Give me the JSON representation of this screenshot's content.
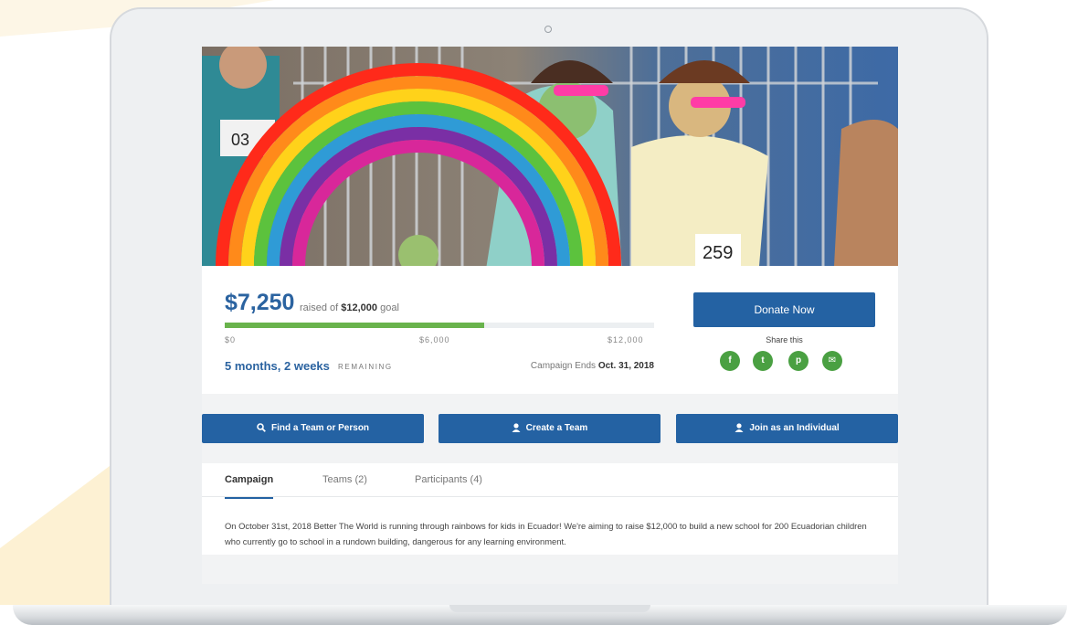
{
  "campaign": {
    "raised_amount": "$7,250",
    "raised_of": "raised of",
    "goal_amount": "$12,000",
    "goal_suffix": "goal",
    "progress_fraction": 0.6042,
    "ticks": [
      "$0",
      "$6,000",
      "$12,000"
    ],
    "remaining_value": "5 months, 2 weeks",
    "remaining_label": "REMAINING",
    "ends_prefix": "Campaign Ends",
    "ends_date": "Oct. 31, 2018"
  },
  "donate": {
    "label": "Donate Now",
    "share_label": "Share this",
    "share_icons": [
      {
        "name": "facebook-icon",
        "glyph": "f"
      },
      {
        "name": "twitter-icon",
        "glyph": "t"
      },
      {
        "name": "pinterest-icon",
        "glyph": "p"
      },
      {
        "name": "email-icon",
        "glyph": "✉"
      }
    ]
  },
  "actions": {
    "find": "Find a Team or Person",
    "create": "Create a Team",
    "join": "Join as an Individual"
  },
  "tabs": {
    "campaign": "Campaign",
    "teams": "Teams (2)",
    "participants": "Participants (4)"
  },
  "description": "On October 31st, 2018 Better The World is running through rainbows for kids in Ecuador! We're aiming to raise $12,000 to build a new school for 200 Ecuadorian children who currently go to school in a rundown building, dangerous for any learning environment.",
  "colors": {
    "primary": "#2462a3",
    "progress": "#69b34c",
    "share": "#4aa042"
  }
}
